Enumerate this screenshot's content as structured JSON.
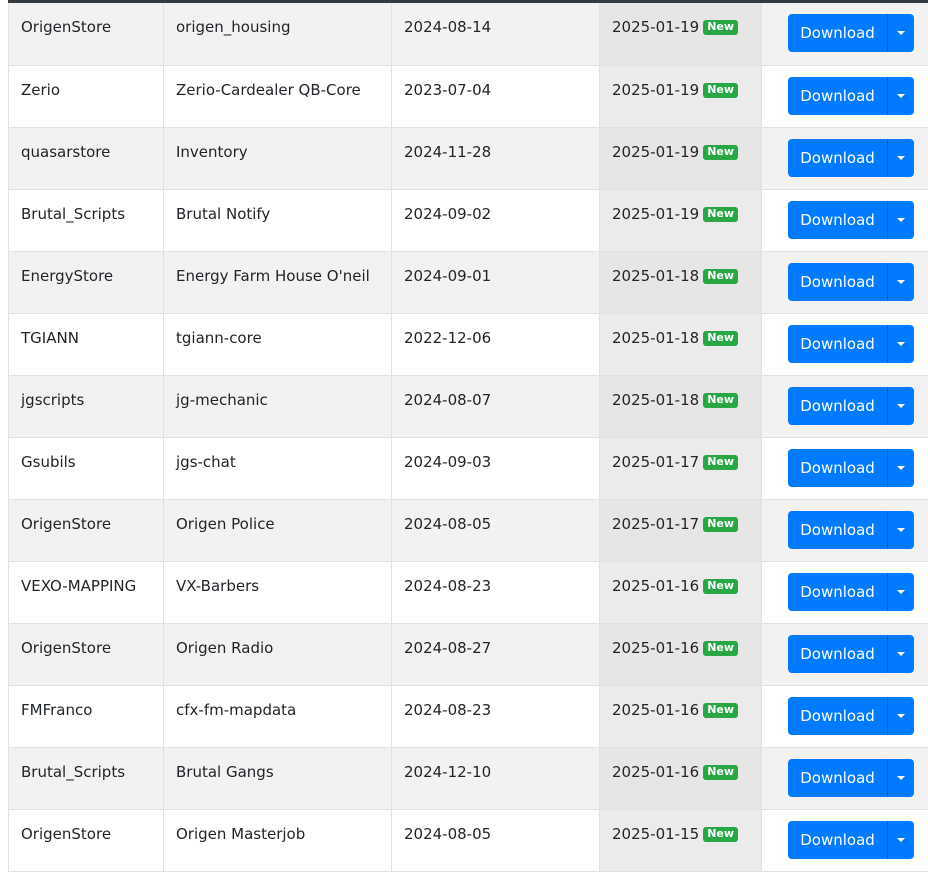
{
  "table": {
    "download_label": "Download",
    "new_badge": "New",
    "rows": [
      {
        "author": "OrigenStore",
        "name": "origen_housing",
        "created": "2024-08-14",
        "updated": "2025-01-19"
      },
      {
        "author": "Zerio",
        "name": "Zerio-Cardealer QB-Core",
        "created": "2023-07-04",
        "updated": "2025-01-19"
      },
      {
        "author": "quasarstore",
        "name": "Inventory",
        "created": "2024-11-28",
        "updated": "2025-01-19"
      },
      {
        "author": "Brutal_Scripts",
        "name": "Brutal Notify",
        "created": "2024-09-02",
        "updated": "2025-01-19"
      },
      {
        "author": "EnergyStore",
        "name": "Energy Farm House O'neil",
        "created": "2024-09-01",
        "updated": "2025-01-18"
      },
      {
        "author": "TGIANN",
        "name": "tgiann-core",
        "created": "2022-12-06",
        "updated": "2025-01-18"
      },
      {
        "author": "jgscripts",
        "name": "jg-mechanic",
        "created": "2024-08-07",
        "updated": "2025-01-18"
      },
      {
        "author": "Gsubils",
        "name": "jgs-chat",
        "created": "2024-09-03",
        "updated": "2025-01-17"
      },
      {
        "author": "OrigenStore",
        "name": "Origen Police",
        "created": "2024-08-05",
        "updated": "2025-01-17"
      },
      {
        "author": "VEXO-MAPPING",
        "name": "VX-Barbers",
        "created": "2024-08-23",
        "updated": "2025-01-16"
      },
      {
        "author": "OrigenStore",
        "name": "Origen Radio",
        "created": "2024-08-27",
        "updated": "2025-01-16"
      },
      {
        "author": "FMFranco",
        "name": "cfx-fm-mapdata",
        "created": "2024-08-23",
        "updated": "2025-01-16"
      },
      {
        "author": "Brutal_Scripts",
        "name": "Brutal Gangs",
        "created": "2024-12-10",
        "updated": "2025-01-16"
      },
      {
        "author": "OrigenStore",
        "name": "Origen Masterjob",
        "created": "2024-08-05",
        "updated": "2025-01-15"
      }
    ]
  },
  "colors": {
    "primary": "#007bff",
    "success": "#28a745",
    "stripe": "#f2f2f2"
  }
}
